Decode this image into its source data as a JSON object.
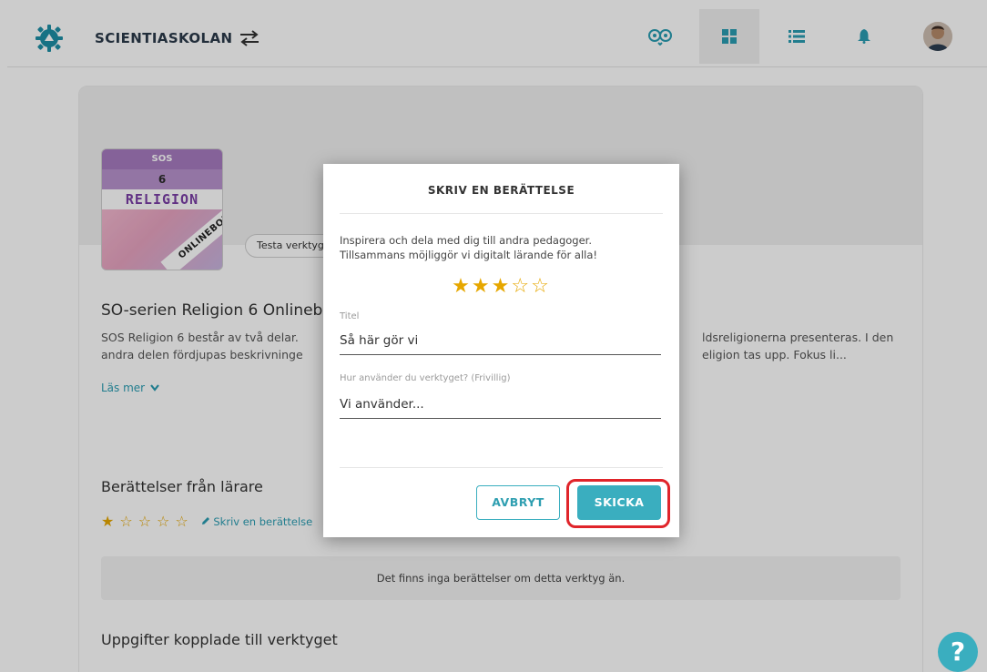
{
  "header": {
    "brand": "SCIENTIASKOLAN",
    "icons": [
      "owl-icon",
      "grid-icon",
      "list-icon",
      "bell-icon",
      "avatar"
    ]
  },
  "tool": {
    "cover_series": "SOS",
    "cover_number": "6",
    "cover_subject": "RELIGION",
    "cover_banner": "ONLINEBOK",
    "test_button": "Testa verktyg",
    "title": "SO-serien Religion 6 Onlineb",
    "description_left": "SOS Religion 6 består av två delar.",
    "description_left_2": "andra delen fördjupas beskrivninge",
    "description_right": "ldsreligionerna presenteras. I den",
    "description_right_2": "eligion tas upp. Fokus li...",
    "read_more": "Läs mer"
  },
  "stories": {
    "title": "Berättelser från lärare",
    "rating": 1,
    "rating_max": 5,
    "write_link": "Skriv en berättelse",
    "empty_text": "Det finns inga berättelser om detta verktyg än."
  },
  "tasks": {
    "title": "Uppgifter kopplade till verktyget"
  },
  "dialog": {
    "title": "SKRIV EN BERÄTTELSE",
    "intro_line1": "Inspirera och dela med dig till andra pedagoger.",
    "intro_line2": "Tillsammans möjliggör vi digitalt lärande för alla!",
    "rating": 3,
    "rating_max": 5,
    "title_label": "Titel",
    "title_value": "Så här gör vi",
    "usage_label": "Hur använder du verktyget? (Frivillig)",
    "usage_placeholder": "Vi använder...",
    "cancel_label": "AVBRYT",
    "send_label": "SKICKA"
  },
  "help": {
    "label": "?"
  },
  "colors": {
    "accent": "#3aaebf",
    "star": "#e6a700",
    "highlight": "#e0242a"
  }
}
